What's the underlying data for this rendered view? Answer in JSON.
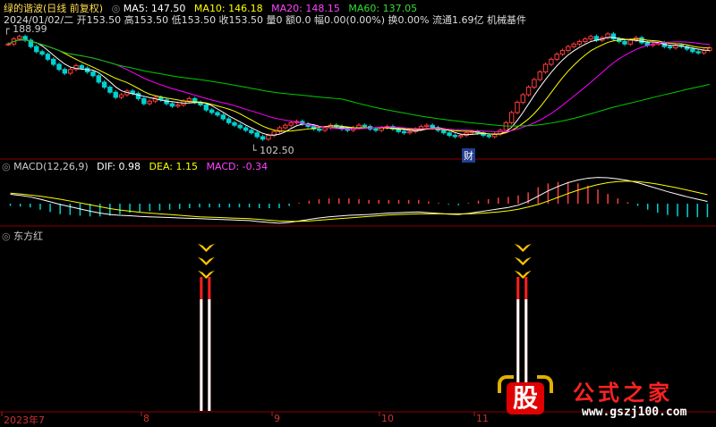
{
  "header": {
    "title": "绿的谐波(日线 前复权)",
    "ma5": "MA5: 147.50",
    "ma10": "MA10: 146.18",
    "ma20": "MA20: 148.15",
    "ma60": "MA60: 137.05",
    "quote": "2024/01/02/二 开153.50 高153.50 低153.50 收153.50 量0 额0.0 幅0.00(0.00%) 换0.00% 流通1.69亿 机械基件"
  },
  "price_markers": {
    "high": "188.99",
    "low": "102.50",
    "event": "财"
  },
  "macd_panel": {
    "title": "MACD(12,26,9)",
    "dif": "DIF: 0.98",
    "dea": "DEA: 1.15",
    "macd": "MACD: -0.34"
  },
  "signal_panel": {
    "title": "东方红"
  },
  "x_axis": {
    "ticks": [
      "2023年7",
      "8",
      "9",
      "10",
      "11"
    ]
  },
  "watermark": {
    "logo": "股",
    "text": "公式之家",
    "url": "www.gszj100.com"
  },
  "colors": {
    "up": "#ff3c3c",
    "down": "#00d0d0",
    "ma5": "#ffffff",
    "ma10": "#ffff00",
    "ma20": "#ff00ff",
    "ma60": "#00cc00",
    "grid": "#8b0000"
  },
  "chart_data": {
    "type": "candlestick",
    "price_ylim": [
      95,
      195
    ],
    "price_max": 188.99,
    "price_min": 102.5,
    "close": [
      180,
      184,
      186,
      183,
      178,
      174,
      172,
      168,
      164,
      160,
      157,
      160,
      163,
      161,
      158,
      155,
      150,
      146,
      142,
      138,
      140,
      143,
      141,
      137,
      133,
      135,
      138,
      136,
      133,
      131,
      132,
      135,
      137,
      134,
      132,
      128,
      126,
      124,
      121,
      118,
      116,
      114,
      112,
      110,
      107,
      105,
      108,
      111,
      114,
      116,
      118,
      119,
      117,
      115,
      113,
      112,
      114,
      116,
      115,
      113,
      112,
      114,
      116,
      115,
      113,
      112,
      114,
      115,
      113,
      111,
      110,
      111,
      113,
      115,
      116,
      114,
      112,
      110,
      108,
      107,
      108,
      110,
      111,
      110,
      108,
      107,
      109,
      112,
      118,
      126,
      134,
      140,
      146,
      152,
      158,
      164,
      168,
      172,
      175,
      178,
      180,
      182,
      184,
      186,
      183,
      185,
      188,
      184,
      182,
      180,
      183,
      185,
      181,
      179,
      180,
      181,
      178,
      177,
      179,
      178,
      176,
      174,
      173,
      175,
      177
    ],
    "macd": {
      "dif": [
        2.5,
        2.2,
        1.8,
        1.2,
        0.5,
        -0.2,
        -0.8,
        -1.4,
        -2,
        -2.5,
        -2.9,
        -3.1,
        -3.2,
        -3.4,
        -3.5,
        -3.6,
        -3.7,
        -3.8,
        -3.9,
        -4,
        -4.1,
        -4.2,
        -4.3,
        -4.4,
        -4.5,
        -4.8,
        -5,
        -5.2,
        -5,
        -4.6,
        -4.2,
        -3.8,
        -3.5,
        -3.3,
        -3.1,
        -3,
        -2.9,
        -2.7,
        -2.5,
        -2.4,
        -2.3,
        -2.2,
        -2.4,
        -2.6,
        -2.8,
        -2.9,
        -2.6,
        -2.2,
        -1.8,
        -1.4,
        -1,
        -0.4,
        0.6,
        2,
        3.4,
        4.6,
        5.6,
        6.3,
        6.8,
        7,
        6.9,
        6.6,
        6.2,
        5.6,
        4.8,
        4,
        3.2,
        2.5,
        1.8,
        1.2,
        0.6
      ],
      "dea": [
        2.8,
        2.6,
        2.3,
        2,
        1.6,
        1.2,
        0.7,
        0.2,
        -0.3,
        -0.8,
        -1.3,
        -1.7,
        -2,
        -2.3,
        -2.5,
        -2.7,
        -2.9,
        -3.1,
        -3.3,
        -3.5,
        -3.6,
        -3.7,
        -3.8,
        -3.9,
        -4,
        -4.2,
        -4.4,
        -4.6,
        -4.7,
        -4.7,
        -4.6,
        -4.4,
        -4.2,
        -4,
        -3.8,
        -3.6,
        -3.4,
        -3.2,
        -3,
        -2.9,
        -2.8,
        -2.7,
        -2.7,
        -2.7,
        -2.7,
        -2.7,
        -2.7,
        -2.6,
        -2.4,
        -2.2,
        -1.9,
        -1.5,
        -0.9,
        -0.2,
        0.7,
        1.7,
        2.7,
        3.6,
        4.4,
        5.1,
        5.6,
        5.9,
        6,
        5.9,
        5.6,
        5.2,
        4.7,
        4.2,
        3.6,
        3,
        2.4
      ]
    },
    "signals": [
      {
        "bar_index": 35,
        "arrows": 3
      },
      {
        "bar_index": 91,
        "arrows": 3
      }
    ]
  }
}
